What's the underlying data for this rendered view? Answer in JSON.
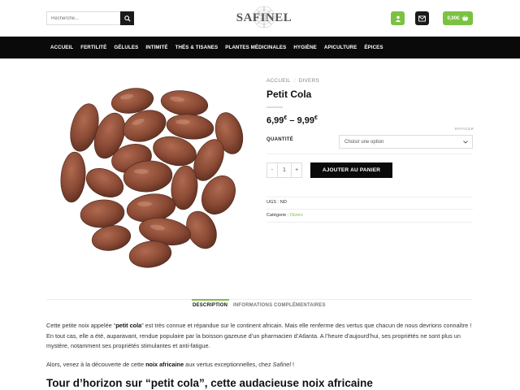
{
  "header": {
    "search_placeholder": "Recherche...",
    "logo_text": "SAFINEL",
    "cart_total": "0,00€"
  },
  "nav": {
    "items": [
      "ACCUEIL",
      "FERTILITÉ",
      "GÉLULES",
      "INTIMITÉ",
      "THÉS & TISANES",
      "PLANTES MÉDICINALES",
      "HYGIÈNE",
      "APICULTURE",
      "ÉPICES"
    ]
  },
  "product": {
    "breadcrumb": [
      "ACCUEIL",
      "DIVERS"
    ],
    "title": "Petit Cola",
    "price_low": "6,99",
    "price_high": "9,99",
    "currency": "€",
    "price_sep": " – ",
    "clear_label": "EFFACER",
    "quantity_label": "QUANTITÉ",
    "select_value": "Choisir une option",
    "qty_minus": "-",
    "qty_value": "1",
    "qty_plus": "+",
    "add_to_cart": "AJOUTER AU PANIER",
    "sku_label": "UGS :",
    "sku_value": "ND",
    "category_label": "Catégorie :",
    "category_value": "Divers"
  },
  "tabs": {
    "description": "DESCRIPTION",
    "additional": "INFORMATIONS COMPLÉMENTAIRES"
  },
  "description": {
    "p1_a": "Cette petite noix appelée “",
    "p1_b": "petit cola",
    "p1_c": "” est très connue et répandue sur le continent africain. Mais elle renferme des vertus que chacun de nous devrions connaître ! En tout cas, elle a été, auparavant, rendue populaire par la boisson gazeuse d’un pharmacien d’Atlanta. A l’heure d’aujourd’hui, ses propriétés ne sont plus un mystère, notamment ses propriétés stimulantes et anti-fatigue.",
    "p2_a": "Alors, venez à la découverte de cette ",
    "p2_b": "noix africaine",
    "p2_c": " aux vertus exceptionnelles, chez ",
    "p2_d": "Safinel",
    "p2_e": " !",
    "heading": "Tour d’horizon sur “petit cola”, cette audacieuse noix africaine"
  },
  "colors": {
    "accent": "#7cc242",
    "dark": "#0a0a0a",
    "bean": "#8a4a35"
  }
}
